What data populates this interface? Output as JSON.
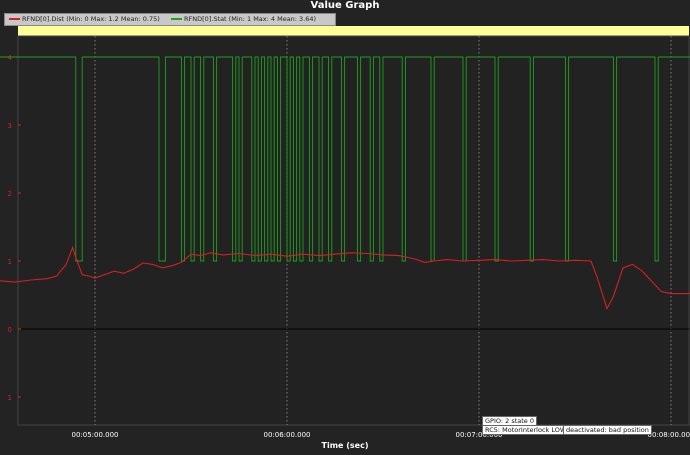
{
  "window": {
    "title": "Value Graph"
  },
  "legend": [
    {
      "label": "RFND[0].Dist  (Min: 0 Max: 1.2 Mean: 0.75)",
      "color": "#d42020"
    },
    {
      "label": "RFND[0].Stat  (Min: 1 Max: 4 Mean: 3.64)",
      "color": "#1fa01f"
    }
  ],
  "messages": [
    {
      "text": "GPIO: 2 state 0"
    },
    {
      "text": "RC5: MotorInterlock LOW"
    },
    {
      "text": "deactivated: bad position"
    }
  ],
  "chart_data": {
    "type": "line",
    "xlabel": "Time (sec)",
    "x_ticks": [
      "00:05:00.000",
      "00:06:00.000",
      "00:07:00.000",
      "00:08:00.000"
    ],
    "y_ticks": [
      "4",
      "3",
      "2",
      "1",
      "0",
      "1",
      "4"
    ],
    "ylim": [
      -1.4,
      4.4
    ],
    "grid": true,
    "series": [
      {
        "name": "RFND[0].Dist",
        "color": "#d42020",
        "points": [
          [
            -80,
            0.68
          ],
          [
            -70,
            0.69
          ],
          [
            -60,
            0.68
          ],
          [
            -50,
            0.7
          ],
          [
            -45,
            0.69
          ],
          [
            -40,
            0.7
          ],
          [
            -35,
            0.69
          ],
          [
            -30,
            0.71
          ],
          [
            -25,
            0.69
          ],
          [
            -20,
            0.72
          ],
          [
            -15,
            0.74
          ],
          [
            -12,
            0.78
          ],
          [
            -9,
            0.95
          ],
          [
            -7,
            1.2
          ],
          [
            -6,
            1.05
          ],
          [
            -4,
            0.8
          ],
          [
            -2,
            0.78
          ],
          [
            0,
            0.75
          ],
          [
            3,
            0.8
          ],
          [
            6,
            0.85
          ],
          [
            9,
            0.82
          ],
          [
            12,
            0.88
          ],
          [
            15,
            0.97
          ],
          [
            18,
            0.95
          ],
          [
            21,
            0.9
          ],
          [
            24,
            0.93
          ],
          [
            27,
            0.98
          ],
          [
            30,
            1.1
          ],
          [
            33,
            1.08
          ],
          [
            36,
            1.12
          ],
          [
            40,
            1.09
          ],
          [
            45,
            1.11
          ],
          [
            50,
            1.08
          ],
          [
            55,
            1.1
          ],
          [
            60,
            1.07
          ],
          [
            65,
            1.1
          ],
          [
            70,
            1.08
          ],
          [
            75,
            1.1
          ],
          [
            80,
            1.12
          ],
          [
            85,
            1.11
          ],
          [
            90,
            1.09
          ],
          [
            95,
            1.08
          ],
          [
            100,
            1.03
          ],
          [
            103,
            0.98
          ],
          [
            106,
            1.0
          ],
          [
            110,
            1.02
          ],
          [
            115,
            1.0
          ],
          [
            120,
            1.01
          ],
          [
            125,
            1.02
          ],
          [
            130,
            1.0
          ],
          [
            135,
            1.01
          ],
          [
            140,
            1.02
          ],
          [
            145,
            1.0
          ],
          [
            150,
            1.01
          ],
          [
            155,
            1.0
          ],
          [
            157,
            0.75
          ],
          [
            159,
            0.45
          ],
          [
            160,
            0.3
          ],
          [
            162,
            0.48
          ],
          [
            165,
            0.9
          ],
          [
            168,
            0.95
          ],
          [
            171,
            0.85
          ],
          [
            174,
            0.7
          ],
          [
            177,
            0.55
          ],
          [
            180,
            0.52
          ],
          [
            185,
            0.52
          ],
          [
            190,
            0.53
          ],
          [
            195,
            0.52
          ],
          [
            200,
            0.55
          ],
          [
            203,
            0.65
          ],
          [
            206,
            0.95
          ],
          [
            210,
            1.05
          ],
          [
            213,
            0.98
          ],
          [
            215,
            1.05
          ],
          [
            217,
            0.92
          ],
          [
            219,
            1.05
          ],
          [
            221,
            0.92
          ],
          [
            223,
            1.05
          ],
          [
            225,
            0.92
          ],
          [
            227,
            1.05
          ],
          [
            229,
            0.92
          ],
          [
            231,
            1.05
          ],
          [
            233,
            0.92
          ],
          [
            235,
            1.05
          ],
          [
            237,
            0.92
          ],
          [
            239,
            1.05
          ],
          [
            241,
            0.92
          ],
          [
            243,
            1.05
          ],
          [
            245,
            0.92
          ],
          [
            247,
            1.05
          ],
          [
            250,
            0.93
          ],
          [
            255,
            0.91
          ],
          [
            260,
            0.9
          ],
          [
            265,
            0.91
          ],
          [
            270,
            0.9
          ],
          [
            275,
            0.89
          ],
          [
            280,
            0.9
          ],
          [
            285,
            0.89
          ],
          [
            290,
            0.9
          ],
          [
            295,
            0.88
          ],
          [
            300,
            0.88
          ],
          [
            302,
            0.7
          ],
          [
            305,
            0.4
          ],
          [
            308,
            0.2
          ],
          [
            310,
            0.0
          ]
        ],
        "extra_segments": [
          [
            [
              340,
              0.0
            ],
            [
              342,
              0.4
            ],
            [
              344,
              0.9
            ],
            [
              346,
              0.95
            ],
            [
              348,
              0.9
            ],
            [
              350,
              1.0
            ],
            [
              351,
              0.6
            ],
            [
              352,
              0.2
            ],
            [
              353,
              0.0
            ]
          ],
          [
            [
              350,
              0.05
            ],
            [
              353,
              0.02
            ],
            [
              356,
              0.08
            ],
            [
              358,
              0.02
            ],
            [
              360,
              0.05
            ]
          ],
          [
            [
              362,
              0.0
            ],
            [
              363,
              0.65
            ],
            [
              364,
              0.0
            ]
          ]
        ]
      },
      {
        "name": "RFND[0].Stat",
        "color": "#1fa01f",
        "base_value": 4,
        "drops_to_1": [
          [
            -6,
            -4
          ],
          [
            20,
            22
          ],
          [
            27,
            28
          ],
          [
            30,
            31
          ],
          [
            33,
            34
          ],
          [
            37,
            38
          ],
          [
            43,
            44
          ],
          [
            45,
            46
          ],
          [
            49,
            50
          ],
          [
            51,
            52
          ],
          [
            53,
            54
          ],
          [
            55,
            56
          ],
          [
            57,
            58
          ],
          [
            60,
            61
          ],
          [
            62,
            63
          ],
          [
            64,
            65
          ],
          [
            67,
            68
          ],
          [
            70,
            71
          ],
          [
            73,
            74
          ],
          [
            77,
            78
          ],
          [
            82,
            83
          ],
          [
            86,
            87
          ],
          [
            89,
            90
          ],
          [
            96,
            97
          ],
          [
            105,
            106
          ],
          [
            115,
            116
          ],
          [
            125,
            126
          ],
          [
            136,
            137
          ],
          [
            147,
            148
          ],
          [
            162,
            163
          ],
          [
            175,
            176
          ],
          [
            191,
            192
          ],
          [
            204,
            205
          ],
          [
            214,
            215
          ],
          [
            258,
            259
          ],
          [
            276,
            277
          ],
          [
            285,
            286
          ],
          [
            287,
            288
          ]
        ],
        "second_phase": [
          [
            300,
            4
          ],
          [
            300,
            2
          ],
          [
            338,
            2
          ],
          [
            338,
            4
          ],
          [
            344,
            4
          ],
          [
            344,
            2
          ],
          [
            348,
            2
          ],
          [
            348,
            4
          ],
          [
            349,
            4
          ],
          [
            349,
            2
          ],
          [
            351,
            2
          ],
          [
            351,
            4
          ],
          [
            352,
            4
          ],
          [
            352,
            2
          ],
          [
            353,
            2
          ],
          [
            353,
            4
          ],
          [
            354,
            4
          ],
          [
            354,
            2
          ],
          [
            356,
            2
          ],
          [
            356,
            4
          ],
          [
            357,
            4
          ],
          [
            357,
            2
          ],
          [
            358,
            2
          ]
        ]
      }
    ]
  }
}
